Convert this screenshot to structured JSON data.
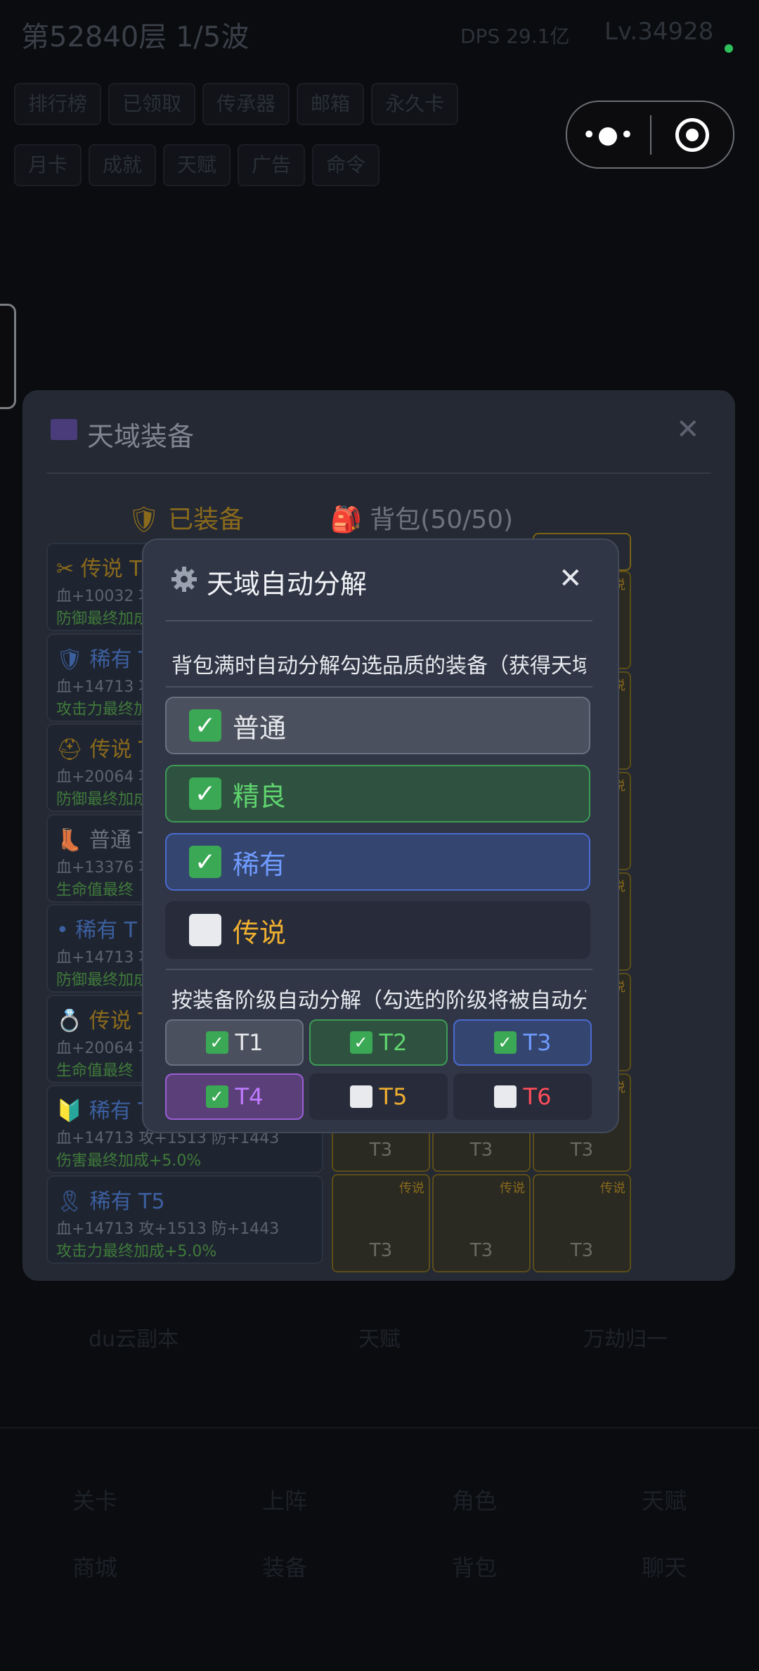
{
  "background": {
    "floor_text": "第52840层 1/5波",
    "dps_text": "DPS 29.1亿",
    "level_text": "Lv.34928",
    "row1": [
      "排行榜",
      "已领取",
      "传承器",
      "邮箱",
      "永久卡"
    ],
    "row2": [
      "月卡",
      "成就",
      "天赋",
      "广告",
      "命令"
    ],
    "bottom_big": [
      "du云副本",
      "天赋",
      "万劫归一"
    ],
    "bottom_row1": [
      "关卡",
      "上阵",
      "角色",
      "天赋"
    ],
    "bottom_row2": [
      "商城",
      "装备",
      "背包",
      "聊天"
    ]
  },
  "miniprogram": {
    "more_glyph": "•●•"
  },
  "panel": {
    "title": "天域装备",
    "close_glyph": "✕",
    "tab_equipped": "🛡 已装备",
    "tab_bag": "🎒 背包(50/50)",
    "cards": [
      {
        "name": "✂ 传说 T",
        "stats": "血+10032 攻",
        "bonus": "防御最终加成",
        "color": "#8a6a1c",
        "bonus_color": "#3f7a3a"
      },
      {
        "name": "🛡 稀有 T",
        "stats": "血+14713 攻",
        "bonus": "攻击力最终加",
        "color": "#3c5fa0",
        "bonus_color": "#3f7a3a"
      },
      {
        "name": "⛑ 传说 T",
        "stats": "血+20064 攻",
        "bonus": "防御最终加成",
        "color": "#8a6a1c",
        "bonus_color": "#3f7a3a"
      },
      {
        "name": "👢 普通 T",
        "stats": "血+13376 攻",
        "bonus": "生命值最终",
        "color": "#6d737e",
        "bonus_color": "#3f7a3a"
      },
      {
        "name": "• 稀有 T",
        "stats": "血+14713 攻",
        "bonus": "防御最终加成",
        "color": "#3c5fa0",
        "bonus_color": "#3f7a3a"
      },
      {
        "name": "💍 传说 T",
        "stats": "血+20064 攻",
        "bonus": "生命值最终",
        "color": "#8a6a1c",
        "bonus_color": "#3f7a3a"
      },
      {
        "name": "🔰 稀有 T",
        "stats": "血+14713 攻+1513 防+1443",
        "bonus": "伤害最终加成+5.0%",
        "color": "#3c5fa0",
        "bonus_color": "#3f7a3a"
      },
      {
        "name": "🎗 稀有 T5",
        "stats": "血+14713 攻+1513 防+1443",
        "bonus": "攻击力最终加成+5.0%",
        "color": "#3c5fa0",
        "bonus_color": "#3f7a3a"
      }
    ],
    "grid_tag": "传说",
    "grid_tier": "T3"
  },
  "modal": {
    "title": "天域自动分解",
    "close_glyph": "✕",
    "desc_quality": "背包满时自动分解勾选品质的装备（获得天域",
    "quality_options": [
      {
        "label": "普通",
        "checked": true,
        "bg": "#4a505d",
        "border": "#6a7080",
        "text": "#e6e8ec"
      },
      {
        "label": "精良",
        "checked": true,
        "bg": "#2f5240",
        "border": "#3d9a55",
        "text": "#5fd56e"
      },
      {
        "label": "稀有",
        "checked": true,
        "bg": "#34456f",
        "border": "#4a6ad0",
        "text": "#6f9bff"
      },
      {
        "label": "传说",
        "checked": false,
        "bg": "#272b3a",
        "border": "#272b3a",
        "text": "#f0b030"
      }
    ],
    "desc_tier": "按装备阶级自动分解（勾选的阶级将被自动分",
    "tiers_row1": [
      {
        "label": "T1",
        "checked": true,
        "bg": "#4a505d",
        "border": "#6a7080",
        "text": "#e6e8ec"
      },
      {
        "label": "T2",
        "checked": true,
        "bg": "#2f5240",
        "border": "#3d9a55",
        "text": "#5fd56e"
      },
      {
        "label": "T3",
        "checked": true,
        "bg": "#34456f",
        "border": "#4a6ad0",
        "text": "#6f9bff"
      }
    ],
    "tiers_row2": [
      {
        "label": "T4",
        "checked": true,
        "bg": "#5a3f78",
        "border": "#9a5ed6",
        "text": "#c07bff"
      },
      {
        "label": "T5",
        "checked": false,
        "bg": "#272b3a",
        "border": "#272b3a",
        "text": "#f0b030"
      },
      {
        "label": "T6",
        "checked": false,
        "bg": "#272b3a",
        "border": "#272b3a",
        "text": "#ff4d5a"
      }
    ],
    "check_glyph": "✓"
  }
}
